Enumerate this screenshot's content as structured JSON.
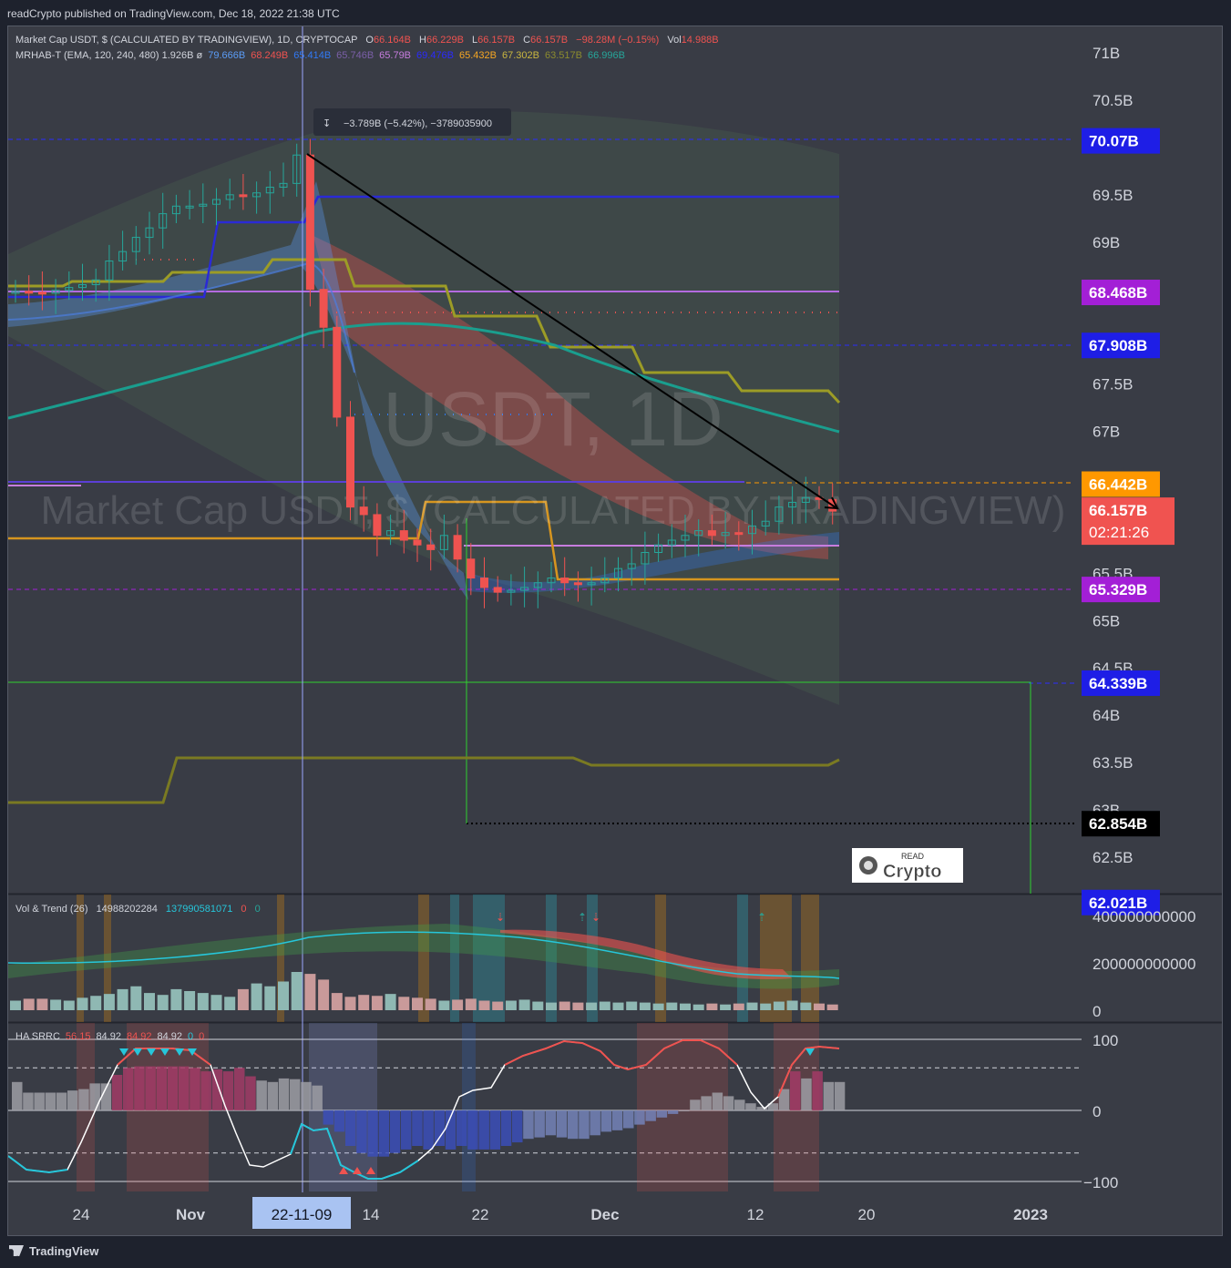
{
  "header": {
    "publisher_line": "readCrypto published on TradingView.com, Dec 18, 2022 21:38 UTC"
  },
  "footer": {
    "brand": "TradingView"
  },
  "colors": {
    "background": "#393c45",
    "panel_bg": "#1e222d",
    "up_candle": "#26a69a",
    "down_candle": "#ef5350",
    "accent_blue": "#1e1ee6",
    "accent_purple": "#a31fd6",
    "accent_orange": "#ff9800",
    "price_red": "#f05350"
  },
  "main_panel": {
    "legend1": {
      "symbol": "Market Cap USDT, $ (CALCULATED BY TRADINGVIEW), 1D, CRYPTOCAP",
      "o_label": "O",
      "o_value": "66.164B",
      "h_label": "H",
      "h_value": "66.229B",
      "l_label": "L",
      "l_value": "66.157B",
      "c_label": "C",
      "c_value": "66.157B",
      "change": "−98.28M (−0.15%)",
      "vol_label": "Vol",
      "vol_value": "14.988B"
    },
    "legend2": {
      "name": "MRHAB-T (EMA, 120, 240, 480) 1.926B ø",
      "values": [
        "79.666B",
        "68.249B",
        "65.414B",
        "65.746B",
        "65.79B",
        "69.476B",
        "65.432B",
        "67.302B",
        "63.517B",
        "66.996B"
      ],
      "value_colors": [
        "#5b9cf6",
        "#ef5350",
        "#3179f5",
        "#7b5fa8",
        "#c77dde",
        "#2a2aff",
        "#f5a623",
        "#c9b640",
        "#8c8c2e",
        "#26a69a"
      ]
    },
    "watermark_ticker": "USDT, 1D",
    "watermark_name": "Market Cap USDT, $ (CALCULATED BY TRADINGVIEW)",
    "measure_label": "−3.789B (−5.42%), −3789035900",
    "logo_text_top": "READ",
    "logo_text_bottom": "Crypto"
  },
  "chart_data": {
    "type": "candlestick",
    "title": "Market Cap USDT, $ (CALCULATED BY TRADINGVIEW), 1D, CRYPTOCAP",
    "x_ticks": [
      "24",
      "Nov",
      "22-11-09",
      "14",
      "22",
      "Dec",
      "12",
      "20",
      "2023"
    ],
    "y_ticks": [
      "71B",
      "70.5B",
      "69.5B",
      "69B",
      "67.5B",
      "67B",
      "65.5B",
      "65B",
      "64.5B",
      "64B",
      "63.5B",
      "63B",
      "62.5B"
    ],
    "ylim": [
      61.8,
      71.3
    ],
    "price_tags": [
      {
        "value": 70.07,
        "label": "70.07B",
        "color": "#1e1ee6"
      },
      {
        "value": 68.468,
        "label": "68.468B",
        "color": "#a31fd6"
      },
      {
        "value": 67.908,
        "label": "67.908B",
        "color": "#1e1ee6"
      },
      {
        "value": 66.442,
        "label": "66.442B",
        "color": "#ff9800"
      },
      {
        "value": 66.157,
        "label": "66.157B",
        "color": "#f05350",
        "countdown": "02:21:26"
      },
      {
        "value": 65.329,
        "label": "65.329B",
        "color": "#a31fd6"
      },
      {
        "value": 64.339,
        "label": "64.339B",
        "color": "#1e1ee6"
      },
      {
        "value": 62.854,
        "label": "62.854B",
        "color": "#000000"
      },
      {
        "value": 62.021,
        "label": "62.021B",
        "color": "#1e1ee6"
      }
    ],
    "candles_close": [
      68.48,
      68.47,
      68.46,
      68.49,
      68.52,
      68.55,
      68.6,
      68.8,
      68.9,
      69.05,
      69.15,
      69.3,
      69.38,
      69.38,
      69.4,
      69.45,
      69.5,
      69.48,
      69.52,
      69.58,
      69.62,
      69.92,
      68.5,
      68.1,
      67.15,
      66.2,
      66.12,
      65.9,
      65.95,
      65.85,
      65.8,
      65.75,
      65.9,
      65.65,
      65.45,
      65.35,
      65.3,
      65.32,
      65.35,
      65.4,
      65.45,
      65.4,
      65.38,
      65.4,
      65.45,
      65.55,
      65.6,
      65.72,
      65.8,
      65.85,
      65.9,
      65.95,
      65.9,
      65.93,
      65.92,
      66.0,
      66.05,
      66.2,
      66.25,
      66.3,
      66.28,
      66.157
    ]
  },
  "vol_panel": {
    "label": "Vol & Trend (26)",
    "value1": "14988202284",
    "value2": "137990581071",
    "value3": "0",
    "value4": "0",
    "y_ticks": [
      "400000000000",
      "200000000000",
      "0"
    ]
  },
  "ha_panel": {
    "label": "HA SRRC",
    "values": [
      "56.15",
      "84.92",
      "84.92",
      "84.92",
      "0",
      "0"
    ],
    "value_colors": [
      "#ef5350",
      "#d1d4dc",
      "#ef5350",
      "#d1d4dc",
      "#26c6da",
      "#ef5350"
    ],
    "y_ticks": [
      "100",
      "0",
      "−100"
    ]
  }
}
